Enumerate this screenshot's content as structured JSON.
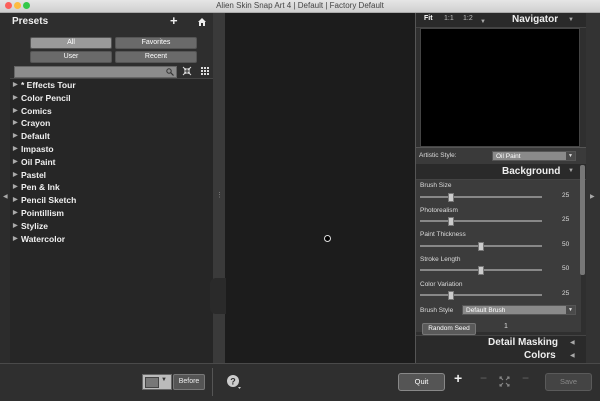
{
  "window": {
    "title": "Alien Skin Snap Art 4 | Default | Factory Default"
  },
  "presets": {
    "title": "Presets",
    "filters": {
      "all": "All",
      "favorites": "Favorites",
      "user": "User",
      "recent": "Recent"
    },
    "search_placeholder": "",
    "items": [
      "* Effects Tour",
      "Color Pencil",
      "Comics",
      "Crayon",
      "Default",
      "Impasto",
      "Oil Paint",
      "Pastel",
      "Pen & Ink",
      "Pencil Sketch",
      "Pointillism",
      "Stylize",
      "Watercolor"
    ]
  },
  "navigator": {
    "title": "Navigator",
    "zoom": {
      "fit": "Fit",
      "one_to_one": "1:1",
      "one_to_two": "1:2"
    }
  },
  "artistic_style": {
    "label": "Artistic Style:",
    "value": "Oil Paint"
  },
  "background": {
    "title": "Background",
    "params": [
      {
        "label": "Brush Size",
        "value": "25",
        "fraction": 0.25
      },
      {
        "label": "Photorealism",
        "value": "25",
        "fraction": 0.25
      },
      {
        "label": "Paint Thickness",
        "value": "50",
        "fraction": 0.5
      },
      {
        "label": "Stroke Length",
        "value": "50",
        "fraction": 0.5
      },
      {
        "label": "Color Variation",
        "value": "25",
        "fraction": 0.25
      }
    ],
    "brush_style": {
      "label": "Brush Style",
      "value": "Default Brush"
    },
    "random_seed": {
      "label": "Random Seed",
      "value": "1"
    }
  },
  "detail_masking": {
    "title": "Detail Masking"
  },
  "colors": {
    "title": "Colors"
  },
  "bottom_bar": {
    "before_label": "Before",
    "quit_label": "Quit",
    "save_label": "Save"
  }
}
